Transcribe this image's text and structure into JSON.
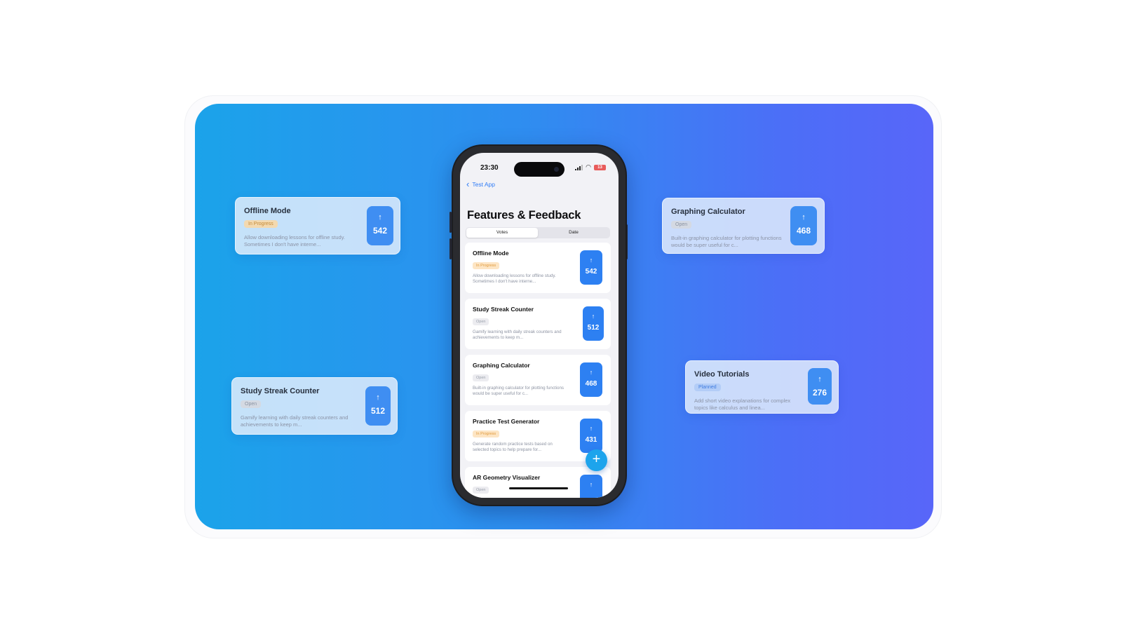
{
  "floating_cards": [
    {
      "title": "Offline Mode",
      "status": "In Progress",
      "status_kind": "progress",
      "description": "Allow downloading lessons for offline study. Sometimes I don't have interne...",
      "votes": "542"
    },
    {
      "title": "Study Streak Counter",
      "status": "Open",
      "status_kind": "open",
      "description": "Gamify learning with daily streak counters and achievements to keep m...",
      "votes": "512"
    },
    {
      "title": "Graphing Calculator",
      "status": "Open",
      "status_kind": "open",
      "description": "Built-in graphing calculator for plotting functions would be super useful for c...",
      "votes": "468"
    },
    {
      "title": "Video Tutorials",
      "status": "Planned",
      "status_kind": "planned",
      "description": "Add short video explanations for complex topics like calculus and linea...",
      "votes": "276"
    }
  ],
  "phone": {
    "status_bar": {
      "time": "23:30",
      "battery": "13"
    },
    "back_label": "Test App",
    "title": "Features & Feedback",
    "sort_options": [
      "Votes",
      "Date"
    ],
    "selected_sort": "Votes",
    "items": [
      {
        "title": "Offline Mode",
        "status": "In Progress",
        "status_kind": "progress",
        "description": "Allow downloading lessons for offline study. Sometimes I don't have interne...",
        "votes": "542"
      },
      {
        "title": "Study Streak Counter",
        "status": "Open",
        "status_kind": "open",
        "description": "Gamify learning with daily streak counters and achievements to keep m...",
        "votes": "512"
      },
      {
        "title": "Graphing Calculator",
        "status": "Open",
        "status_kind": "open",
        "description": "Built-in graphing calculator for plotting functions would be super useful for c...",
        "votes": "468"
      },
      {
        "title": "Practice Test Generator",
        "status": "In Progress",
        "status_kind": "progress",
        "description": "Generate random practice tests based on selected topics to help prepare for...",
        "votes": "431"
      },
      {
        "title": "AR Geometry Visualizer",
        "status": "Open",
        "status_kind": "open",
        "description": "",
        "votes": ""
      }
    ],
    "fab_icon": "plus-icon"
  },
  "icons": {
    "upvote": "arrow-up-icon",
    "back": "chevron-left-icon",
    "add": "plus-icon"
  },
  "colors": {
    "accent": "#2d80f2",
    "fab": "#1da4ec",
    "gradient_start": "#1ba3ea",
    "gradient_end": "#5866f9"
  }
}
